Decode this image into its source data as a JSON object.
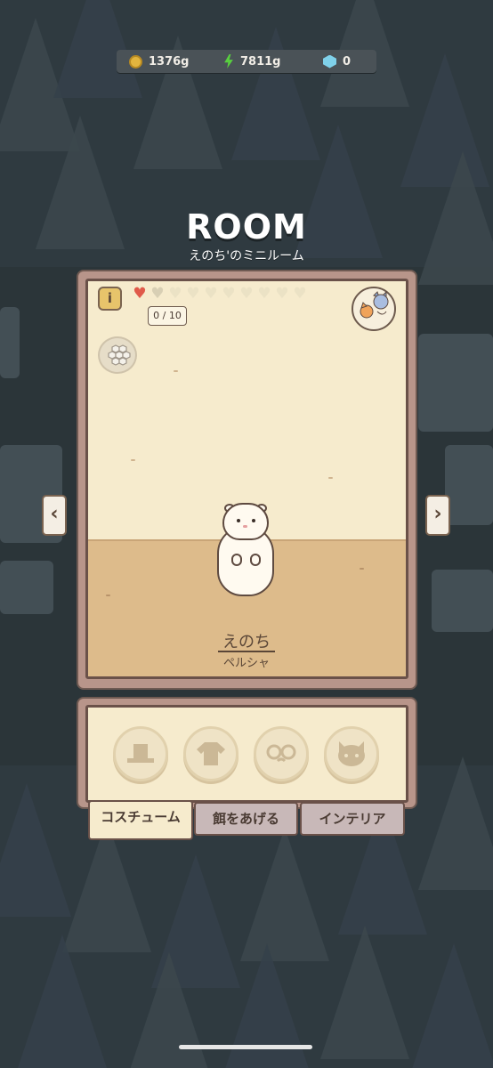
{
  "resources": {
    "gold": "1376g",
    "energy": "7811g",
    "gems": "0"
  },
  "room": {
    "title": "ROOM",
    "subtitle": "えのち'のミニルーム",
    "info_label": "i",
    "affection": {
      "filled_hearts": 1,
      "total_hearts": 10,
      "progress_text": "0 / 10"
    },
    "prev_arrow": "‹",
    "next_arrow": "›"
  },
  "pet": {
    "name": "えのち",
    "breed": "ペルシャ"
  },
  "tabs": [
    {
      "label": "コスチューム",
      "active": true
    },
    {
      "label": "餌をあげる",
      "active": false
    },
    {
      "label": "インテリア",
      "active": false
    }
  ],
  "costume_slots": [
    "hat-icon",
    "shirt-icon",
    "glasses-icon",
    "cat-face-icon"
  ],
  "colors": {
    "accent_heart": "#e05a4a",
    "background": "#2f3a40",
    "panel": "#b8958a",
    "paper": "#f6ebcd"
  }
}
